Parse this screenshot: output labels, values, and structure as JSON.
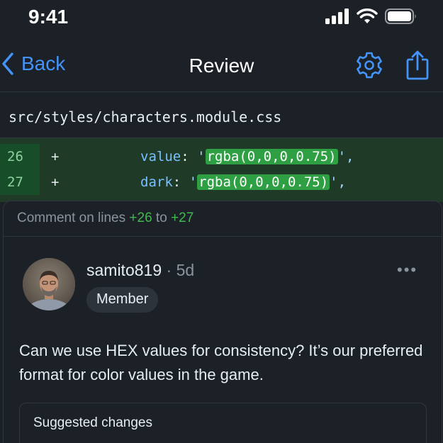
{
  "status_bar": {
    "time": "9:41"
  },
  "nav": {
    "back_label": "Back",
    "title": "Review"
  },
  "file": {
    "path": "src/styles/characters.module.css"
  },
  "diff": {
    "lines": [
      {
        "number": "26",
        "sign": "+",
        "key": "value",
        "colon": ":",
        "open_quote": "'",
        "value": "rgba(0,0,0,0.75)",
        "close": "',",
        "change_type": "addition"
      },
      {
        "number": "27",
        "sign": "+",
        "key": "dark",
        "colon": ":",
        "open_quote": "'",
        "value": "rgba(0,0,0,0.75)",
        "close": "',",
        "change_type": "addition"
      }
    ]
  },
  "comment_thread": {
    "header_prefix": "Comment on lines",
    "line_start": "+26",
    "header_to": "to",
    "line_end": "+27"
  },
  "comment": {
    "author": "samito819",
    "separator": "·",
    "age": "5d",
    "more_label": "•••",
    "role_badge": "Member",
    "body": "Can we use HEX values for consistency? It’s our preferred format for color values in the game."
  },
  "suggestion": {
    "label": "Suggested changes"
  },
  "colors": {
    "accent": "#4493f8",
    "addition": "#3fb950",
    "background": "#1c2128",
    "diff_background": "#1f3a27"
  },
  "icons": [
    "signal-icon",
    "wifi-icon",
    "battery-icon",
    "chevron-left-icon",
    "gear-icon",
    "share-icon",
    "avatar"
  ]
}
